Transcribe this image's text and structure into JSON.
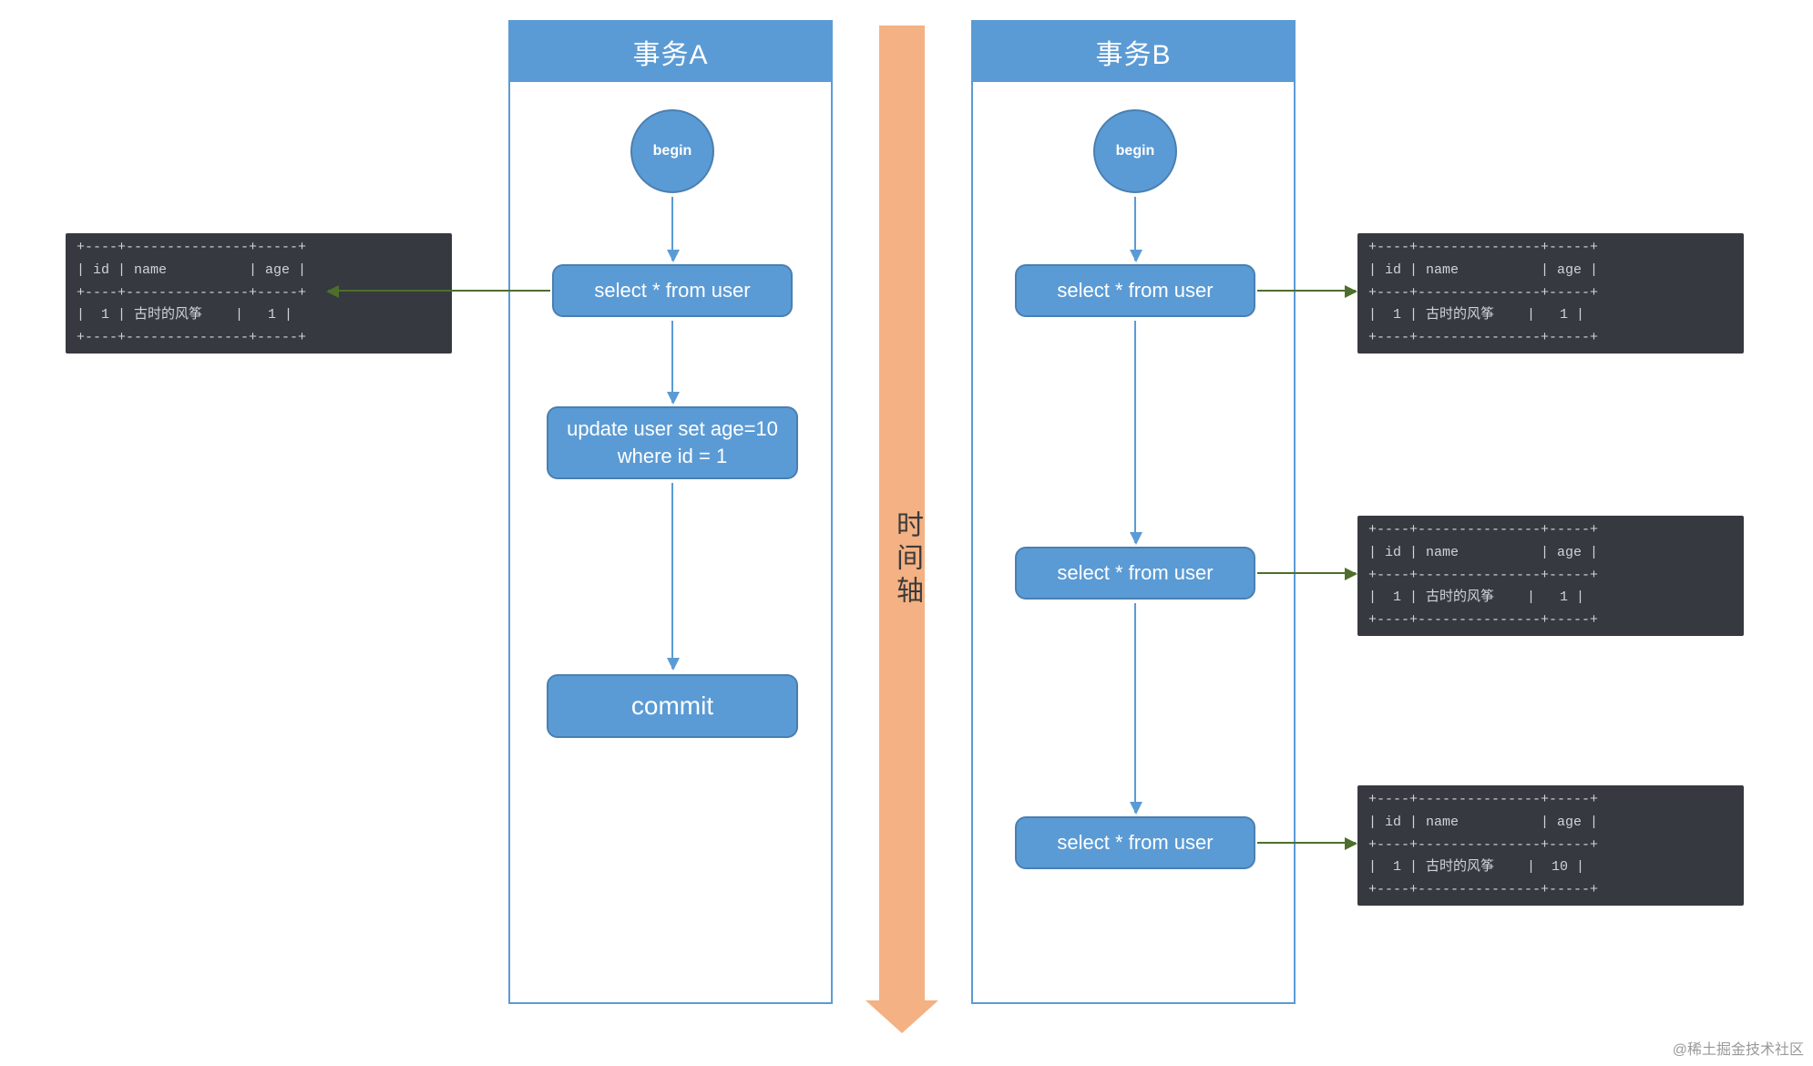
{
  "timeline_label": "时间轴",
  "watermark": "@稀土掘金技术社区",
  "tx_a": {
    "title": "事务A",
    "begin": "begin",
    "steps": {
      "select": "select * from user",
      "update": "update user set age=10\nwhere id = 1",
      "commit": "commit"
    }
  },
  "tx_b": {
    "title": "事务B",
    "begin": "begin",
    "steps": {
      "select1": "select * from user",
      "select2": "select * from user",
      "select3": "select * from user"
    }
  },
  "tables": {
    "header": "+----+---------------+-----+\n| id | name          | age |\n+----+---------------+-----+",
    "footer": "+----+---------------+-----+",
    "row_age1": "|  1 | 古时的风筝    |   1 |",
    "row_age10": "|  1 | 古时的风筝    |  10 |"
  }
}
